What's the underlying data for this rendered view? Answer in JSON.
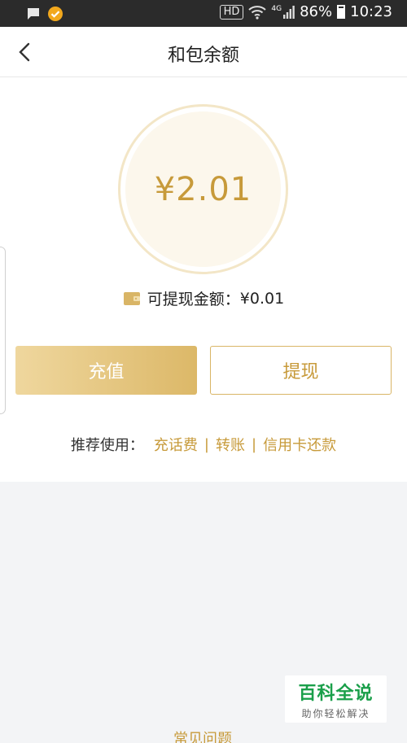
{
  "status_bar": {
    "hd_label": "HD",
    "network_label": "4G",
    "battery": "86%",
    "time": "10:23"
  },
  "header": {
    "title": "和包余额"
  },
  "balance": {
    "amount": "¥2.01",
    "withdrawable_label": "可提现金额：",
    "withdrawable_amount": "¥0.01"
  },
  "actions": {
    "recharge_label": "充值",
    "withdraw_label": "提现"
  },
  "recommend": {
    "prefix": "推荐使用：",
    "items": [
      "充话费",
      "转账",
      "信用卡还款"
    ],
    "separator": "|"
  },
  "faq": {
    "label": "常见问题"
  },
  "watermark": {
    "main": "百科全说",
    "sub": "助你轻松解决"
  },
  "colors": {
    "accent": "#c79a3a",
    "button_gradient_start": "#efd79e",
    "button_gradient_end": "#dcb868",
    "status_bar_bg": "#2b2b2b"
  }
}
